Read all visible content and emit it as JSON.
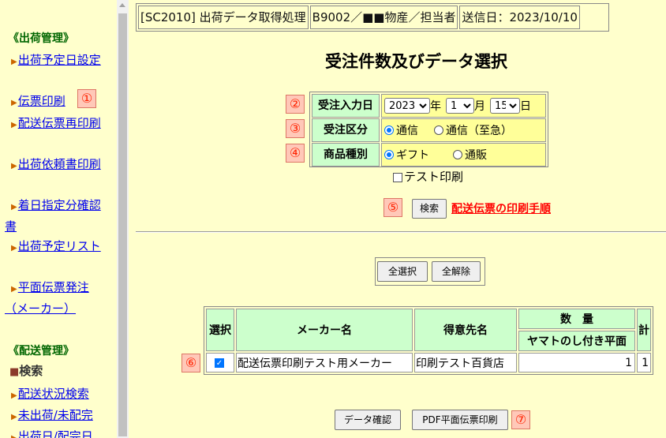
{
  "header": {
    "screen_code": "[SC2010] 出荷データ取得処理",
    "user": "B9002／■■物産／担当者",
    "send_date": "送信日：2023/10/10"
  },
  "page_title": "受注件数及びデータ選択",
  "sidebar": {
    "section1_title": "《出荷管理》",
    "section1_items": [
      {
        "label": "出荷予定日設定"
      },
      {
        "label": "伝票印刷"
      },
      {
        "label": "配送伝票再印刷"
      },
      {
        "label": "出荷依頼書印刷"
      },
      {
        "label": "着日指定分確認書"
      },
      {
        "label": "出荷予定リスト"
      },
      {
        "label": "平面伝票発注（メーカー）"
      }
    ],
    "section2_title": "《配送管理》",
    "section2_items": [
      {
        "label": "検索",
        "current": true
      },
      {
        "label": "配送状況検索"
      },
      {
        "label": "未出荷/未配完"
      },
      {
        "label": "出荷日/配完日"
      }
    ]
  },
  "badges": [
    "①",
    "②",
    "③",
    "④",
    "⑤",
    "⑥",
    "⑦"
  ],
  "form": {
    "order_date_label": "受注入力日",
    "year": "2023",
    "year_unit": "年",
    "month": "1",
    "month_unit": "月",
    "day": "15",
    "day_unit": "日",
    "order_type_label": "受注区分",
    "order_type_options": [
      "通信",
      "通信（至急）"
    ],
    "order_type_selected": "通信",
    "product_type_label": "商品種別",
    "product_type_options": [
      "ギフト",
      "通販"
    ],
    "product_type_selected": "ギフト",
    "test_print_label": "テスト印刷"
  },
  "search_button": "検索",
  "help_link": "配送伝票の印刷手順",
  "select_all_button": "全選択",
  "deselect_all_button": "全解除",
  "table": {
    "headers": {
      "select": "選択",
      "maker": "メーカー名",
      "customer": "得意先名",
      "quantity": "数　量",
      "quantity_sub": "ヤマトのし付き平面",
      "total": "計"
    },
    "rows": [
      {
        "checked": true,
        "maker": "配送伝票印刷テスト用メーカー",
        "customer": "印刷テスト百貨店",
        "qty": "1",
        "total": "1"
      }
    ]
  },
  "confirm_button": "データ確認",
  "pdf_button": "PDF平面伝票印刷",
  "colors": {
    "background": "#ffffcc",
    "label_bg": "#ccffcc",
    "value_bg": "#ffff99",
    "link": "#0000ee",
    "accent_red": "#ff0000"
  }
}
